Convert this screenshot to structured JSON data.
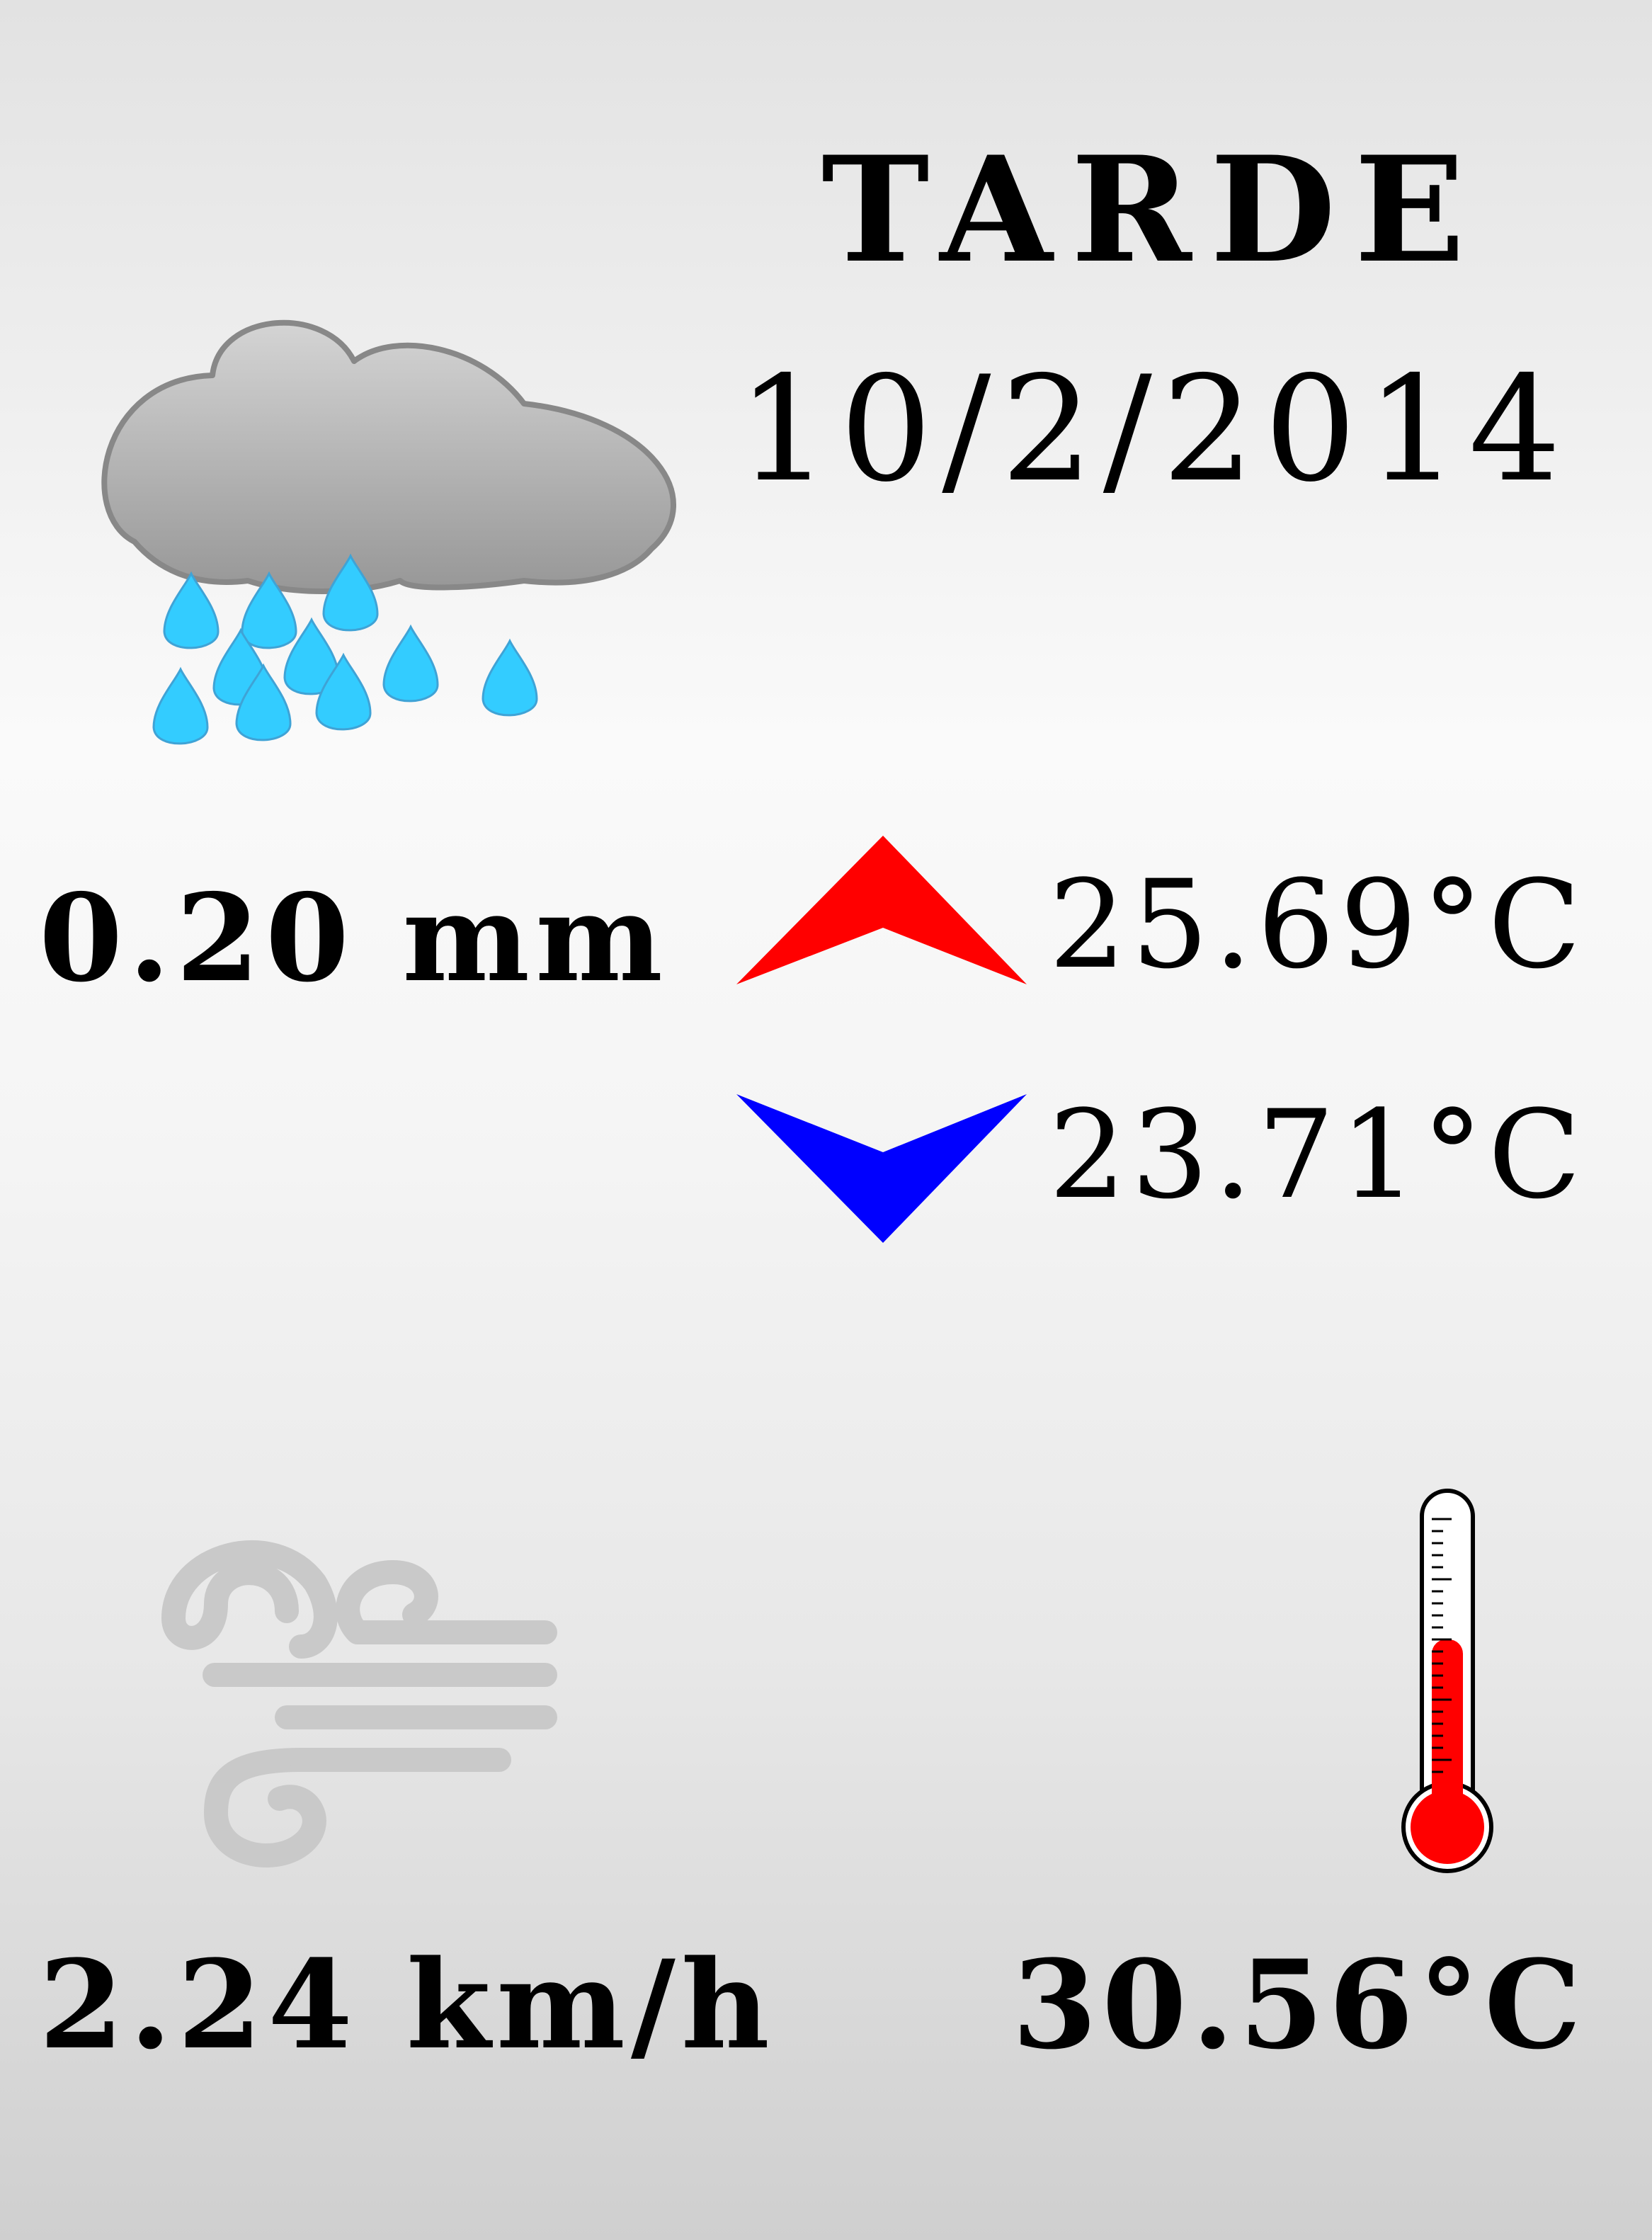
{
  "forecast": {
    "period": "TARDE",
    "date": "10/2/2014",
    "precipitation": "0.20 mm",
    "temp_max": "25.69°C",
    "temp_min": "23.71°C",
    "wind_speed": "2.24 km/h",
    "temperature": "30.56°C"
  },
  "icons": {
    "weather": "rain-cloud-icon",
    "max": "arrow-up-icon",
    "min": "arrow-down-icon",
    "wind": "wind-icon",
    "thermometer": "thermometer-icon"
  },
  "colors": {
    "max_arrow": "#ff0000",
    "min_arrow": "#0000ff",
    "thermometer_fill": "#ff0000",
    "raindrop": "#33ccff",
    "cloud": "#aaaaaa",
    "wind": "#c7c7c7"
  },
  "thermometer_level": 0.6
}
